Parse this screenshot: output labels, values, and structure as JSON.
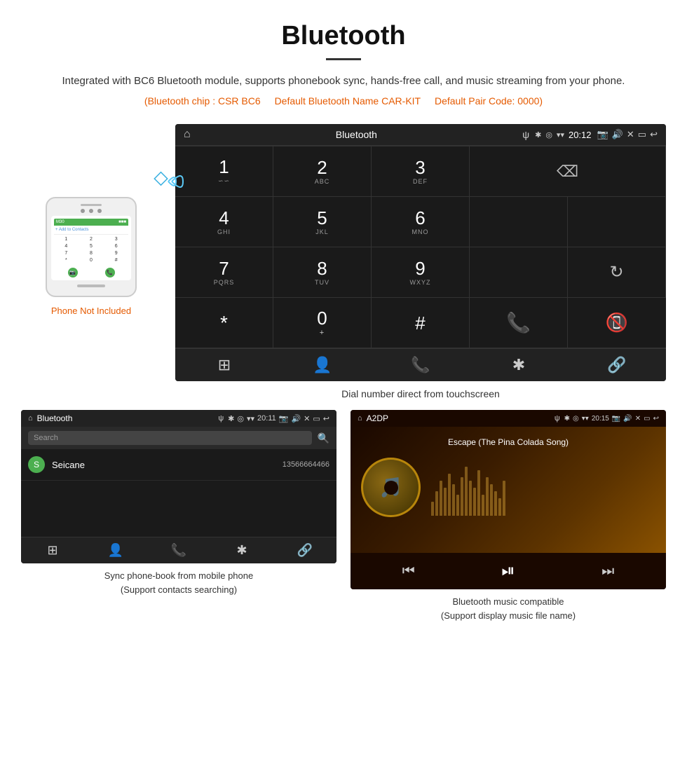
{
  "header": {
    "title": "Bluetooth",
    "description": "Integrated with BC6 Bluetooth module, supports phonebook sync, hands-free call, and music streaming from your phone.",
    "specs_chip": "(Bluetooth chip : CSR BC6",
    "specs_name": "Default Bluetooth Name CAR-KIT",
    "specs_code": "Default Pair Code: 0000)"
  },
  "device_screen": {
    "status_bar": {
      "title": "Bluetooth",
      "usb_symbol": "ψ",
      "time": "20:12"
    },
    "dialpad": {
      "keys": [
        {
          "main": "1",
          "sub": "∽∽"
        },
        {
          "main": "2",
          "sub": "ABC"
        },
        {
          "main": "3",
          "sub": "DEF"
        },
        {
          "main": "",
          "sub": ""
        },
        {
          "main": "⌫",
          "sub": ""
        },
        {
          "main": "4",
          "sub": "GHI"
        },
        {
          "main": "5",
          "sub": "JKL"
        },
        {
          "main": "6",
          "sub": "MNO"
        },
        {
          "main": "",
          "sub": ""
        },
        {
          "main": "",
          "sub": ""
        },
        {
          "main": "7",
          "sub": "PQRS"
        },
        {
          "main": "8",
          "sub": "TUV"
        },
        {
          "main": "9",
          "sub": "WXYZ"
        },
        {
          "main": "",
          "sub": ""
        },
        {
          "main": "↻",
          "sub": ""
        },
        {
          "main": "*",
          "sub": ""
        },
        {
          "main": "0",
          "sub": "+"
        },
        {
          "main": "#",
          "sub": ""
        },
        {
          "main": "📞",
          "sub": ""
        },
        {
          "main": "📵",
          "sub": ""
        }
      ]
    },
    "bottom_nav": [
      "⊞",
      "👤",
      "📞",
      "✱",
      "🔗"
    ]
  },
  "main_caption": "Dial number direct from touchscreen",
  "phone_not_included": "Phone Not Included",
  "phonebook_screen": {
    "status_bar": {
      "title": "Bluetooth",
      "usb": "ψ",
      "time": "20:11"
    },
    "search_placeholder": "Search",
    "contacts": [
      {
        "letter": "S",
        "name": "Seicane",
        "number": "13566664466"
      }
    ],
    "bottom_nav": [
      "⊞",
      "👤",
      "📞",
      "✱",
      "🔗"
    ]
  },
  "phonebook_caption": {
    "line1": "Sync phone-book from mobile phone",
    "line2": "(Support contacts searching)"
  },
  "music_screen": {
    "status_bar": {
      "title": "A2DP",
      "usb": "ψ",
      "time": "20:15"
    },
    "song_title": "Escape (The Pina Colada Song)",
    "controls": [
      "⏮",
      "⏯",
      "⏭"
    ]
  },
  "music_caption": {
    "line1": "Bluetooth music compatible",
    "line2": "(Support display music file name)"
  }
}
